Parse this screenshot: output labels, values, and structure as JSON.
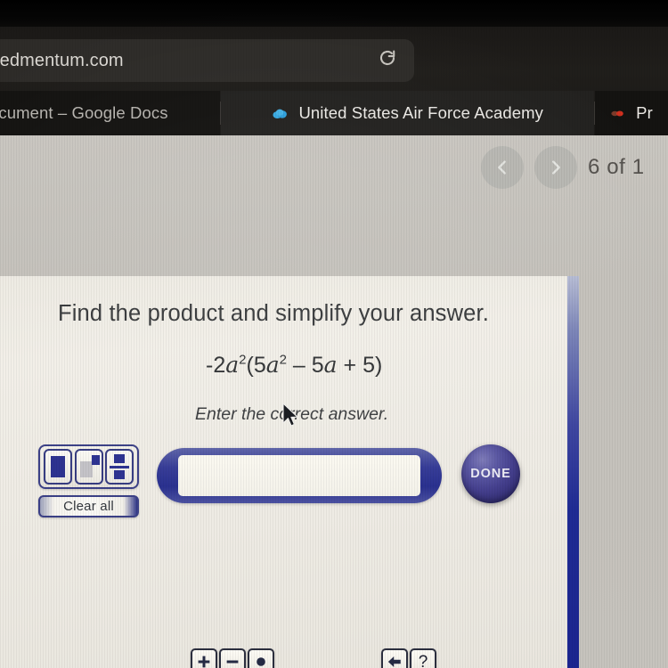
{
  "browser": {
    "url": ".edmentum.com",
    "reload_icon": "reload-icon",
    "tabs": [
      {
        "label": "ocument – Google Docs",
        "favicon": "none",
        "active": false
      },
      {
        "label": "United States Air Force Academy",
        "favicon": "cloud-icon",
        "active": true
      },
      {
        "label": "Pr",
        "favicon": "red-dot-icon",
        "active": false
      }
    ]
  },
  "pager": {
    "prev_icon": "chevron-left-icon",
    "next_icon": "chevron-right-icon",
    "counter": "6 of 1"
  },
  "question": {
    "title": "Find the product and simplify your answer.",
    "expression": {
      "coefficient": "-2",
      "var1": "a",
      "exp1": "2",
      "open_paren": "(",
      "term1_coef": "5",
      "var2": "a",
      "exp2": "2",
      "minus": " – ",
      "term2": "5",
      "var3": "a",
      "plus": " + ",
      "term3": "5",
      "close_paren": ")"
    },
    "instruction": "Enter the correct answer."
  },
  "answer": {
    "value": "",
    "placeholder": ""
  },
  "palette": {
    "buttons": [
      {
        "name": "box-template",
        "label": ""
      },
      {
        "name": "exponent-template",
        "label": ""
      },
      {
        "name": "fraction-template",
        "label": ""
      }
    ],
    "clear_all_label": "Clear all"
  },
  "operators": {
    "left": [
      {
        "name": "plus-icon",
        "symbol": "+"
      },
      {
        "name": "minus-icon",
        "symbol": "–"
      },
      {
        "name": "decimal-point-icon",
        "symbol": "●"
      }
    ],
    "right": [
      {
        "name": "backspace-icon",
        "symbol": "←"
      },
      {
        "name": "help-icon",
        "symbol": "?"
      }
    ]
  },
  "done": {
    "label": "DONE"
  },
  "colors": {
    "accent_blue": "#2b3190",
    "done_purple": "#443f8e",
    "card_bg": "#eeebe4",
    "page_bg": "#c6c3bd",
    "chrome_dark": "#201e1b"
  }
}
